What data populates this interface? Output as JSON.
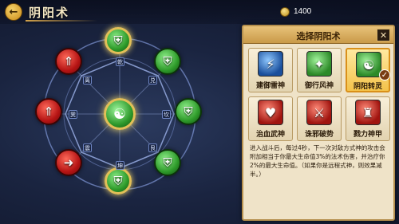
{
  "header": {
    "title": "阴阳术",
    "back_label": "←",
    "currency_value": "1400"
  },
  "wheel": {
    "trigram_labels": [
      "乾",
      "坎",
      "艮",
      "坤",
      "震",
      "巽",
      "离",
      "兑"
    ],
    "nodes": [
      {
        "color": "green",
        "symbol": "shield-icon",
        "ring": "gold"
      },
      {
        "color": "green",
        "symbol": "shield-icon"
      },
      {
        "color": "green",
        "symbol": "shield-icon"
      },
      {
        "color": "green",
        "symbol": "shield-icon"
      },
      {
        "color": "green",
        "symbol": "shield-icon",
        "ring": "gold"
      },
      {
        "color": "red",
        "symbol": "arrow-icon"
      },
      {
        "color": "red",
        "symbol": "arrow-icon"
      },
      {
        "color": "red",
        "symbol": "arrow-icon"
      }
    ]
  },
  "panel": {
    "title": "选择阴阳术",
    "close_label": "✕",
    "skills": [
      {
        "label": "建御雷神",
        "color": "blue",
        "glyph": "⚡"
      },
      {
        "label": "御行风神",
        "color": "green",
        "glyph": "✦"
      },
      {
        "label": "阴阳转灵",
        "color": "green",
        "glyph": "☯",
        "selected": true
      },
      {
        "label": "治血武神",
        "color": "red",
        "glyph": "♥"
      },
      {
        "label": "诛邪破势",
        "color": "red",
        "glyph": "⚔"
      },
      {
        "label": "戮力神甲",
        "color": "red",
        "glyph": "♜"
      }
    ],
    "description": "进入战斗后，每过4秒，下一次对敌方式神的攻击会附加相当于你最大生命值3%的法术伤害，并治疗你2%的最大生命值。（如果你是远程式神，则效果减半。）"
  },
  "colors": {
    "accent_gold": "#e2bf58",
    "panel_bg": "#efe3c8"
  }
}
